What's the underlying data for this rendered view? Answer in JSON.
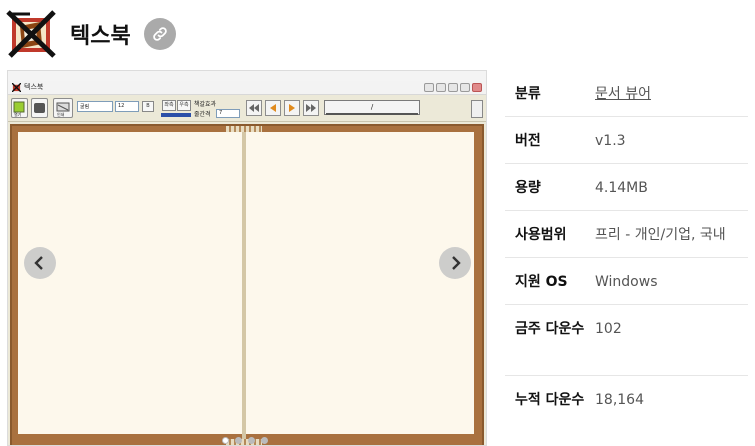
{
  "app": {
    "title": "텍스북",
    "link_icon": "link-icon",
    "logo_icon": "textbook-logo-icon"
  },
  "gallery": {
    "screenshot": {
      "window_title": "텍스북",
      "font_select": "굴림",
      "size_select": "12",
      "spacing_label": "줄간격",
      "spacing_value": "7",
      "check_label": "책갈효과",
      "page_field": "/",
      "btn_open_label": "열기",
      "btn_save_label": "저장",
      "btn_print_label": "인쇄",
      "btn_b1_label": "B",
      "btn_s1_label": "좌측",
      "btn_s2_label": "우측"
    },
    "prev_icon": "chevron-left-icon",
    "next_icon": "chevron-right-icon",
    "dot_count": 4,
    "active_dot": 0
  },
  "info": {
    "rows": [
      {
        "label": "분류",
        "value": "문서 뷰어",
        "is_link": true
      },
      {
        "label": "버전",
        "value": "v1.3",
        "is_link": false
      },
      {
        "label": "용량",
        "value": "4.14MB",
        "is_link": false
      },
      {
        "label": "사용범위",
        "value": "프리 - 개인/기업, 국내",
        "is_link": false
      },
      {
        "label": "지원 OS",
        "value": "Windows",
        "is_link": false
      },
      {
        "label": "금주 다운수",
        "value": "102",
        "is_link": false
      },
      {
        "label": "누적 다운수",
        "value": "18,164",
        "is_link": false
      }
    ]
  },
  "colors": {
    "book_cover": "#a9713f",
    "page": "#fdf8ec",
    "link_button": "#aaaaaa"
  }
}
